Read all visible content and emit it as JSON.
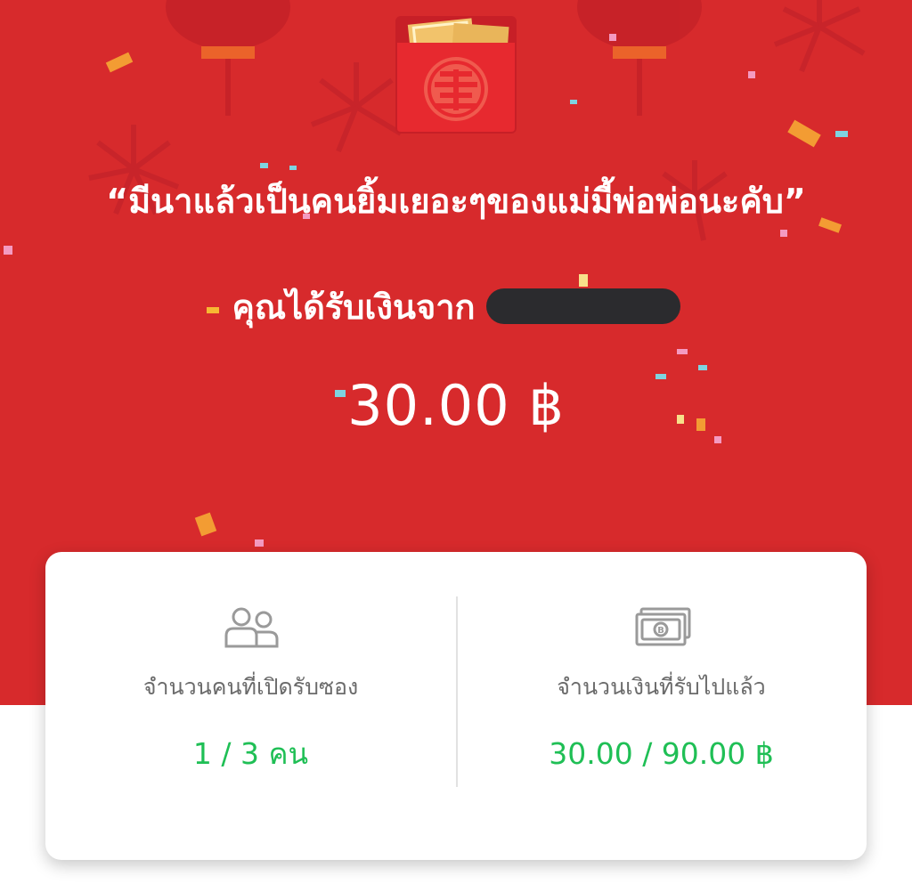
{
  "colors": {
    "background_red": "#d72a2c",
    "accent_green": "#1fbf55",
    "label_gray": "#6b6b6b",
    "redaction": "#2b2b2e"
  },
  "hero": {
    "envelope_icon": "red-envelope-icon",
    "message": "“มีนาแล้วเป็นคนยิ้มเยอะๆของแม่มี้พ่อพ่อนะคับ”",
    "sender_label": "คุณได้รับเงินจาก",
    "amount": "30.00 ฿"
  },
  "stats": {
    "opened": {
      "icon": "people-icon",
      "label": "จำนวนคนที่เปิดรับซอง",
      "value": "1 / 3 คน"
    },
    "received": {
      "icon": "banknote-icon",
      "label": "จำนวนเงินที่รับไปแล้ว",
      "value": "30.00 / 90.00 ฿"
    }
  }
}
